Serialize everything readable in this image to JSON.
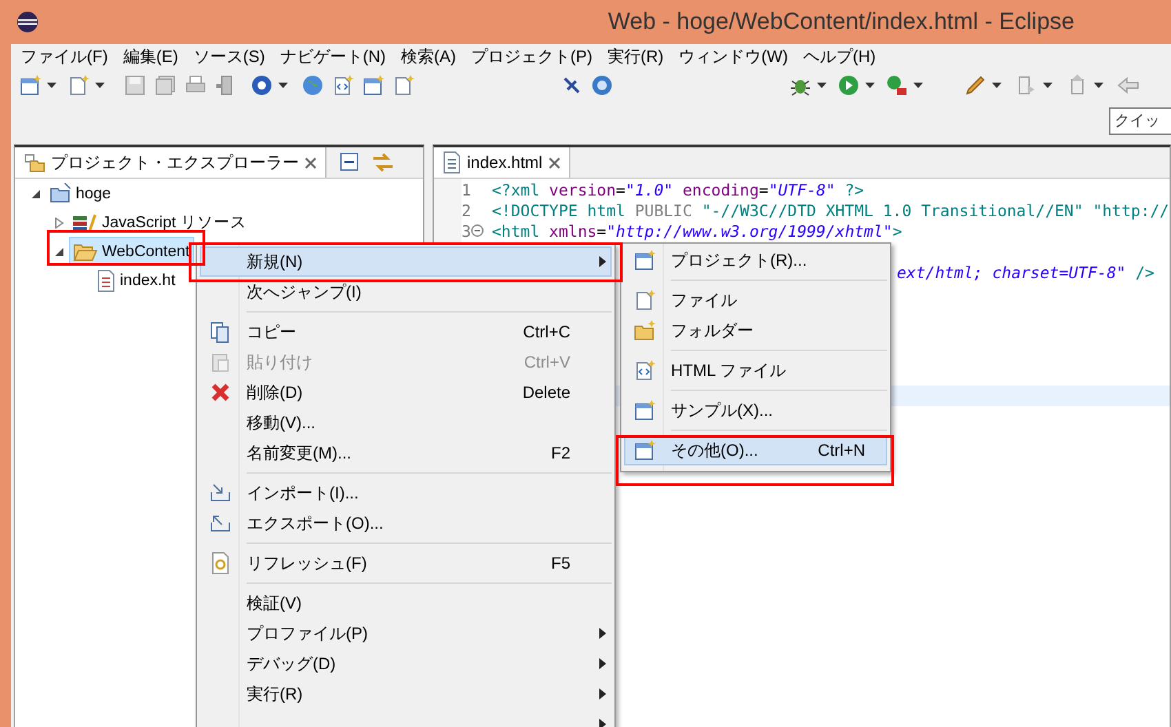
{
  "window": {
    "title": "Web - hoge/WebContent/index.html - Eclipse"
  },
  "menu_bar": [
    "ファイル(F)",
    "編集(E)",
    "ソース(S)",
    "ナビゲート(N)",
    "検索(A)",
    "プロジェクト(P)",
    "実行(R)",
    "ウィンドウ(W)",
    "ヘルプ(H)"
  ],
  "quick_access": {
    "placeholder": "クイッ"
  },
  "explorer": {
    "tab": {
      "label": "プロジェクト・エクスプローラー",
      "selected": true
    },
    "tree": [
      {
        "label": "hoge",
        "kind": "project",
        "selected": false,
        "expanded": true,
        "children": [
          {
            "label": "JavaScript リソース",
            "kind": "library",
            "selected": false,
            "expanded": false
          },
          {
            "label": "WebContent",
            "kind": "folder",
            "selected": true,
            "expanded": true,
            "children": [
              {
                "label": "index.ht",
                "kind": "file",
                "selected": false
              }
            ]
          }
        ]
      }
    ]
  },
  "editor": {
    "tabs": [
      {
        "label": "index.html",
        "selected": true
      }
    ],
    "lines": [
      {
        "kind": "numbered",
        "number": "1",
        "fold_open": false,
        "tokens": [
          {
            "kind": "tag",
            "text": "<?xml"
          },
          {
            "kind": "attr",
            "text": " version"
          },
          {
            "kind": "plain",
            "text": "="
          },
          {
            "kind": "string",
            "text": "\"1.0\""
          },
          {
            "kind": "attr",
            "text": " encoding"
          },
          {
            "kind": "plain",
            "text": "="
          },
          {
            "kind": "string",
            "text": "\"UTF-8\""
          },
          {
            "kind": "tag",
            "text": " ?>"
          }
        ]
      },
      {
        "kind": "numbered",
        "number": "2",
        "fold_open": false,
        "tokens": [
          {
            "kind": "tag",
            "text": "<!DOCTYPE html"
          },
          {
            "kind": "keyword",
            "text": " PUBLIC"
          },
          {
            "kind": "tag",
            "text": " \"-//W3C//DTD XHTML 1.0 Transitional//EN\" \"http://"
          }
        ]
      },
      {
        "kind": "numbered",
        "number": "3",
        "fold_open": true,
        "tokens": [
          {
            "kind": "tag",
            "text": "<html"
          },
          {
            "kind": "attr",
            "text": " xmlns"
          },
          {
            "kind": "plain",
            "text": "="
          },
          {
            "kind": "string",
            "text": "\"http://www.w3.org/1999/xhtml\""
          },
          {
            "kind": "tag",
            "text": ">"
          }
        ]
      },
      {
        "kind": "fragment",
        "tokens": [
          {
            "kind": "string",
            "text": "ext/html; charset=UTF-8\""
          },
          {
            "kind": "tag",
            "text": " />"
          }
        ]
      }
    ]
  },
  "context_menu": {
    "items": [
      {
        "kind": "item",
        "label": "新規(N)",
        "submenu": true,
        "selected": true,
        "disabled": false
      },
      {
        "kind": "item",
        "label": "次へジャンプ(I)",
        "submenu": false,
        "selected": false,
        "disabled": false
      },
      {
        "kind": "separator"
      },
      {
        "kind": "item",
        "label": "コピー",
        "shortcut": "Ctrl+C",
        "submenu": false,
        "selected": false,
        "disabled": false
      },
      {
        "kind": "item",
        "label": "貼り付け",
        "shortcut": "Ctrl+V",
        "submenu": false,
        "selected": false,
        "disabled": true
      },
      {
        "kind": "item",
        "label": "削除(D)",
        "shortcut": "Delete",
        "submenu": false,
        "selected": false,
        "disabled": false
      },
      {
        "kind": "item",
        "label": "移動(V)...",
        "submenu": false,
        "selected": false,
        "disabled": false
      },
      {
        "kind": "item",
        "label": "名前変更(M)...",
        "shortcut": "F2",
        "submenu": false,
        "selected": false,
        "disabled": false
      },
      {
        "kind": "separator"
      },
      {
        "kind": "item",
        "label": "インポート(I)...",
        "submenu": false,
        "selected": false,
        "disabled": false
      },
      {
        "kind": "item",
        "label": "エクスポート(O)...",
        "submenu": false,
        "selected": false,
        "disabled": false
      },
      {
        "kind": "separator"
      },
      {
        "kind": "item",
        "label": "リフレッシュ(F)",
        "shortcut": "F5",
        "submenu": false,
        "selected": false,
        "disabled": false
      },
      {
        "kind": "separator"
      },
      {
        "kind": "item",
        "label": "検証(V)",
        "submenu": false,
        "selected": false,
        "disabled": false
      },
      {
        "kind": "item",
        "label": "プロファイル(P)",
        "submenu": true,
        "selected": false,
        "disabled": false
      },
      {
        "kind": "item",
        "label": "デバッグ(D)",
        "submenu": true,
        "selected": false,
        "disabled": false
      },
      {
        "kind": "item",
        "label": "実行(R)",
        "submenu": true,
        "selected": false,
        "disabled": false
      },
      {
        "kind": "item",
        "submenu": true,
        "selected": false,
        "disabled": false
      }
    ]
  },
  "submenu": {
    "items": [
      {
        "kind": "item",
        "label": "プロジェクト(R)...",
        "selected": false
      },
      {
        "kind": "separator"
      },
      {
        "kind": "item",
        "label": "ファイル",
        "selected": false
      },
      {
        "kind": "item",
        "label": "フォルダー",
        "selected": false
      },
      {
        "kind": "separator"
      },
      {
        "kind": "item",
        "label": "HTML ファイル",
        "selected": false
      },
      {
        "kind": "separator"
      },
      {
        "kind": "item",
        "label": "サンプル(X)...",
        "selected": false
      },
      {
        "kind": "separator"
      },
      {
        "kind": "item",
        "label": "その他(O)...",
        "shortcut": "Ctrl+N",
        "selected": true
      }
    ]
  }
}
